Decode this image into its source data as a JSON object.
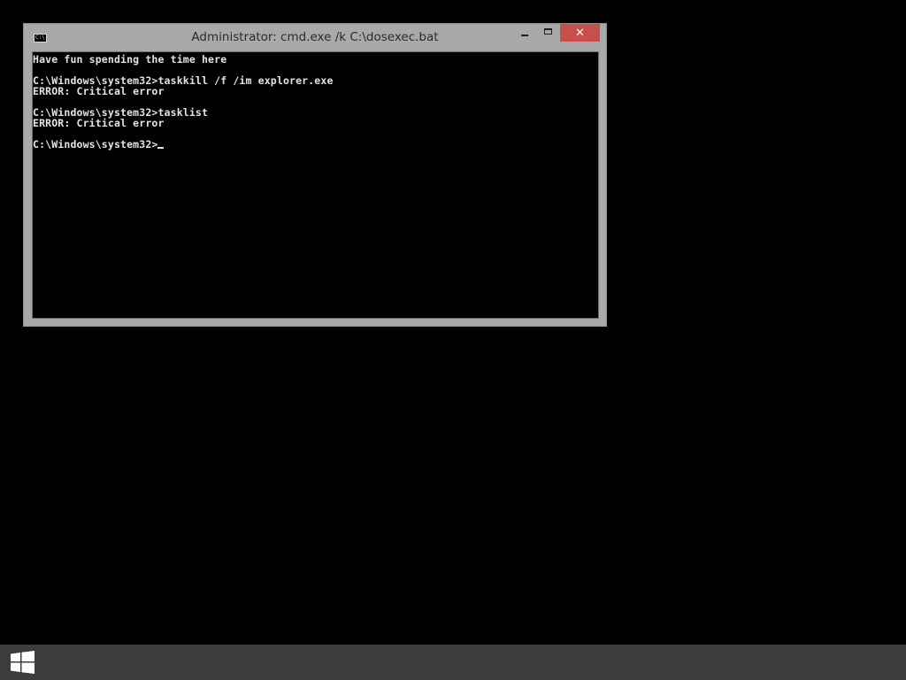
{
  "window": {
    "title": "Administrator: cmd.exe /k C:\\dosexec.bat",
    "app_icon_text": "C:\\.",
    "icons": {
      "app": "cmd-app-icon",
      "minimize": "minimize-icon",
      "maximize": "maximize-icon",
      "close": "close-icon"
    },
    "close_glyph": "✕"
  },
  "console": {
    "lines": [
      "Have fun spending the time here",
      "",
      "C:\\Windows\\system32>taskkill /f /im explorer.exe",
      "ERROR: Critical error",
      "",
      "C:\\Windows\\system32>tasklist",
      "ERROR: Critical error",
      "",
      "C:\\Windows\\system32>"
    ]
  },
  "taskbar": {
    "start_icon": "windows-logo-icon"
  },
  "colors": {
    "desktop": "#000000",
    "window_frame": "#a9a9a9",
    "close_button": "#c7504c",
    "console_text": "#e4e4e4",
    "taskbar": "#3c3c3c"
  }
}
